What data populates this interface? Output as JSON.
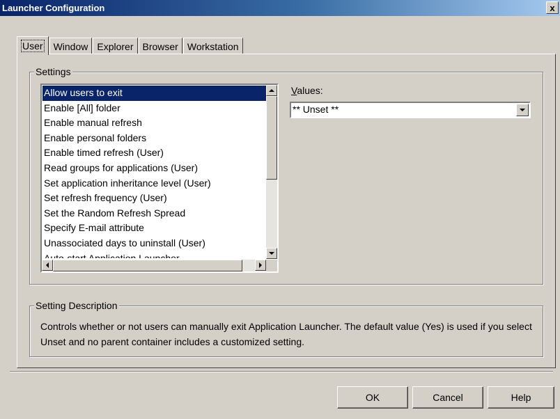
{
  "window": {
    "title": "Launcher Configuration",
    "close_label": "x"
  },
  "tabs": [
    {
      "label": "User",
      "active": true
    },
    {
      "label": "Window"
    },
    {
      "label": "Explorer"
    },
    {
      "label": "Browser"
    },
    {
      "label": "Workstation"
    }
  ],
  "settings": {
    "legend": "Settings",
    "items": [
      "Allow users to exit",
      "Enable [All] folder",
      "Enable manual refresh",
      "Enable personal folders",
      "Enable timed refresh (User)",
      "Read groups for applications (User)",
      "Set application inheritance level (User)",
      "Set refresh frequency (User)",
      "Set the Random Refresh Spread",
      "Specify E-mail attribute",
      "Unassociated days to uninstall (User)",
      "Auto-start Application Launcher"
    ],
    "selected_index": 0,
    "values_label_accesskey": "V",
    "values_label_rest": "alues:",
    "values_selected": "** Unset **"
  },
  "description": {
    "legend": "Setting Description",
    "text": "Controls whether or not users can manually exit Application Launcher. The default value (Yes) is used if you select Unset and no parent container includes a customized setting."
  },
  "buttons": {
    "ok": "OK",
    "cancel": "Cancel",
    "help": "Help"
  },
  "colors": {
    "selection": "#0a246a",
    "face": "#d4d0c8",
    "title_start": "#0a246a"
  }
}
